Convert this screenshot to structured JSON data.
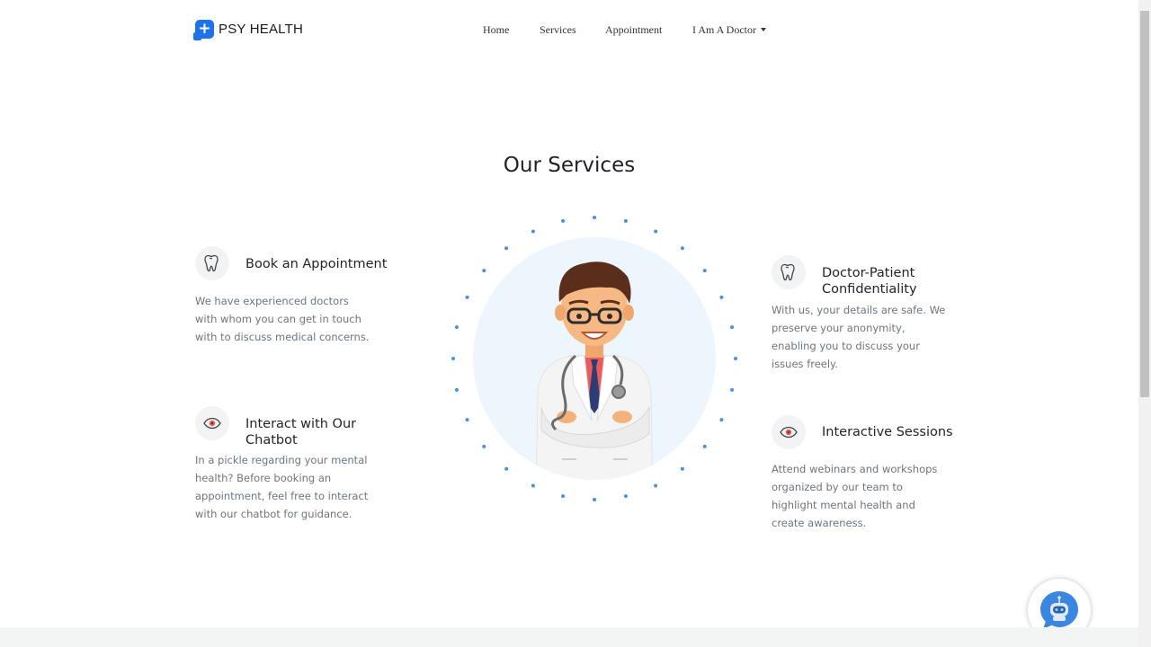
{
  "brand": {
    "name": "PSY HEALTH",
    "logo_icon": "medical-cross-icon"
  },
  "nav": {
    "items": [
      {
        "label": "Home"
      },
      {
        "label": "Services"
      },
      {
        "label": "Appointment"
      },
      {
        "label": "I Am A Doctor"
      }
    ]
  },
  "section": {
    "title": "Our Services"
  },
  "services": [
    {
      "title": "Book an Appointment",
      "description": "We have experienced doctors with whom you can get in touch with to discuss medical concerns.",
      "icon": "tooth-icon"
    },
    {
      "title": "Interact with Our Chatbot",
      "description": "In a pickle regarding your mental health? Before booking an appointment, feel free to interact with our chatbot for guidance.",
      "icon": "eye-icon"
    },
    {
      "title": "Doctor-Patient Confidentiality",
      "description": "With us, your details are safe. We preserve your anonymity, enabling you to discuss your issues freely.",
      "icon": "tooth-icon"
    },
    {
      "title": "Interactive Sessions",
      "description": "Attend webinars and workshops organized by our team to highlight mental health and create awareness.",
      "icon": "eye-icon"
    }
  ],
  "colors": {
    "accent": "#1e73e8",
    "dots": "#4a90e2",
    "illustration_bg": "#eef6fd"
  },
  "chatbot": {
    "icon": "robot-chat-icon"
  }
}
